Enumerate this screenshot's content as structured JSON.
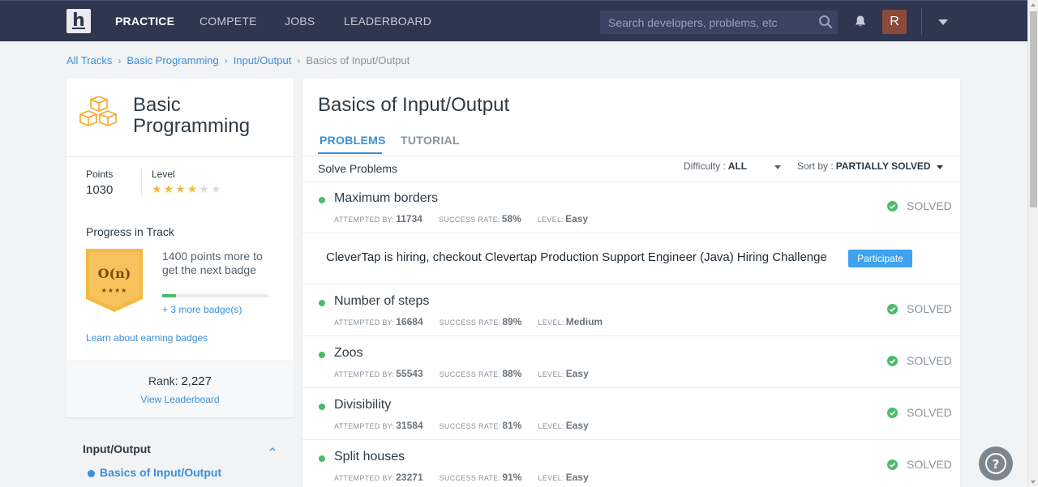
{
  "nav": {
    "items": [
      "PRACTICE",
      "COMPETE",
      "JOBS",
      "LEADERBOARD"
    ],
    "active": "PRACTICE",
    "search_placeholder": "Search developers, problems, etc",
    "avatar_initial": "R"
  },
  "breadcrumb": [
    "All Tracks",
    "Basic Programming",
    "Input/Output",
    "Basics of Input/Output"
  ],
  "track": {
    "title": "Basic Programming",
    "points_label": "Points",
    "points_value": "1030",
    "level_label": "Level",
    "level_stars_filled": 4,
    "level_stars_total": 6,
    "progress_title": "Progress in Track",
    "badge_text": "O(n)",
    "progress_text": "1400 points more to get the next badge",
    "progress_fraction": 0.13,
    "more_badges": "+ 3 more badge(s)",
    "learn_link": "Learn about earning badges",
    "rank_label": "Rank:",
    "rank_value": "2,227",
    "leaderboard_link": "View Leaderboard"
  },
  "sidebar": {
    "section": "Input/Output",
    "active_item": "Basics of Input/Output"
  },
  "main": {
    "title": "Basics of Input/Output",
    "tabs": [
      "PROBLEMS",
      "TUTORIAL"
    ],
    "active_tab": "PROBLEMS",
    "solve_label": "Solve Problems",
    "difficulty_label": "Difficulty :",
    "difficulty_value": "ALL",
    "sort_label": "Sort by :",
    "sort_value": "PARTIALLY SOLVED",
    "meta_labels": {
      "attempted": "ATTEMPTED BY:",
      "success": "SUCCESS RATE:",
      "level": "LEVEL:"
    },
    "problems": [
      {
        "name": "Maximum borders",
        "attempted": "11734",
        "success": "58%",
        "level": "Easy",
        "status": "SOLVED"
      },
      {
        "name": "Number of steps",
        "attempted": "16684",
        "success": "89%",
        "level": "Medium",
        "status": "SOLVED"
      },
      {
        "name": "Zoos",
        "attempted": "55543",
        "success": "88%",
        "level": "Easy",
        "status": "SOLVED"
      },
      {
        "name": "Divisibility",
        "attempted": "31584",
        "success": "81%",
        "level": "Easy",
        "status": "SOLVED"
      },
      {
        "name": "Split houses",
        "attempted": "23271",
        "success": "91%",
        "level": "Easy",
        "status": "SOLVED"
      }
    ],
    "promo": {
      "text": "CleverTap is hiring, checkout Clevertap Production Support Engineer (Java) Hiring Challenge",
      "button": "Participate"
    }
  },
  "colors": {
    "navbar": "#2f3650",
    "accent": "#3a8fd9",
    "success": "#4cbb6c",
    "star": "#f5b942",
    "badge": "#f5b942"
  }
}
